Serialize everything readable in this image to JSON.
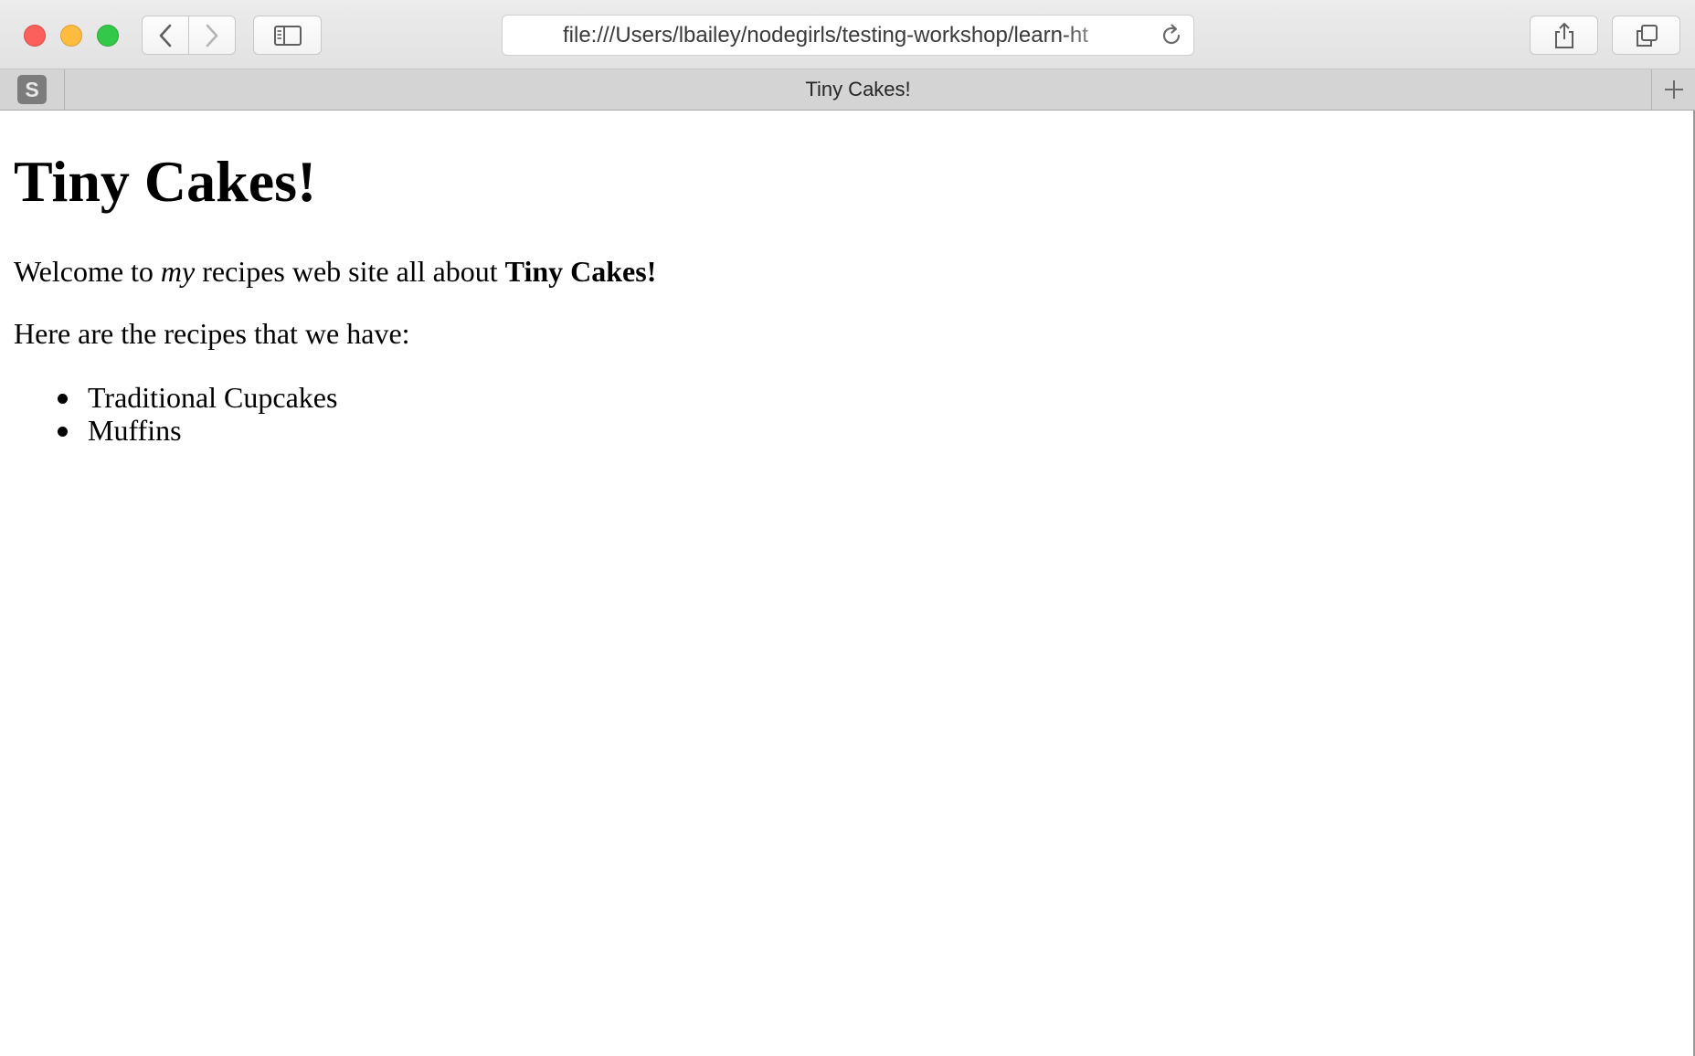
{
  "window": {
    "traffic_lights": [
      "close",
      "minimize",
      "zoom"
    ],
    "colors": {
      "close": "#fc605c",
      "minimize": "#fdbc40",
      "zoom": "#34c84a"
    }
  },
  "toolbar": {
    "back_icon": "chevron-left-icon",
    "forward_icon": "chevron-right-icon",
    "sidebar_icon": "sidebar-icon",
    "share_icon": "share-icon",
    "tabs_icon": "tabs-overview-icon"
  },
  "address_bar": {
    "url": "file:///Users/lbailey/nodegirls/testing-workshop/learn-ht",
    "reload_icon": "reload-icon"
  },
  "tabs": {
    "pinned": {
      "label": "S"
    },
    "active": {
      "title": "Tiny Cakes!"
    },
    "new_tab_icon": "plus-icon"
  },
  "page": {
    "heading": "Tiny Cakes!",
    "welcome": {
      "prefix": "Welcome to ",
      "emphasis": "my",
      "middle": " recipes web site all about ",
      "strong": "Tiny Cakes!"
    },
    "intro": "Here are the recipes that we have:",
    "recipes": [
      "Traditional Cupcakes",
      "Muffins"
    ]
  }
}
